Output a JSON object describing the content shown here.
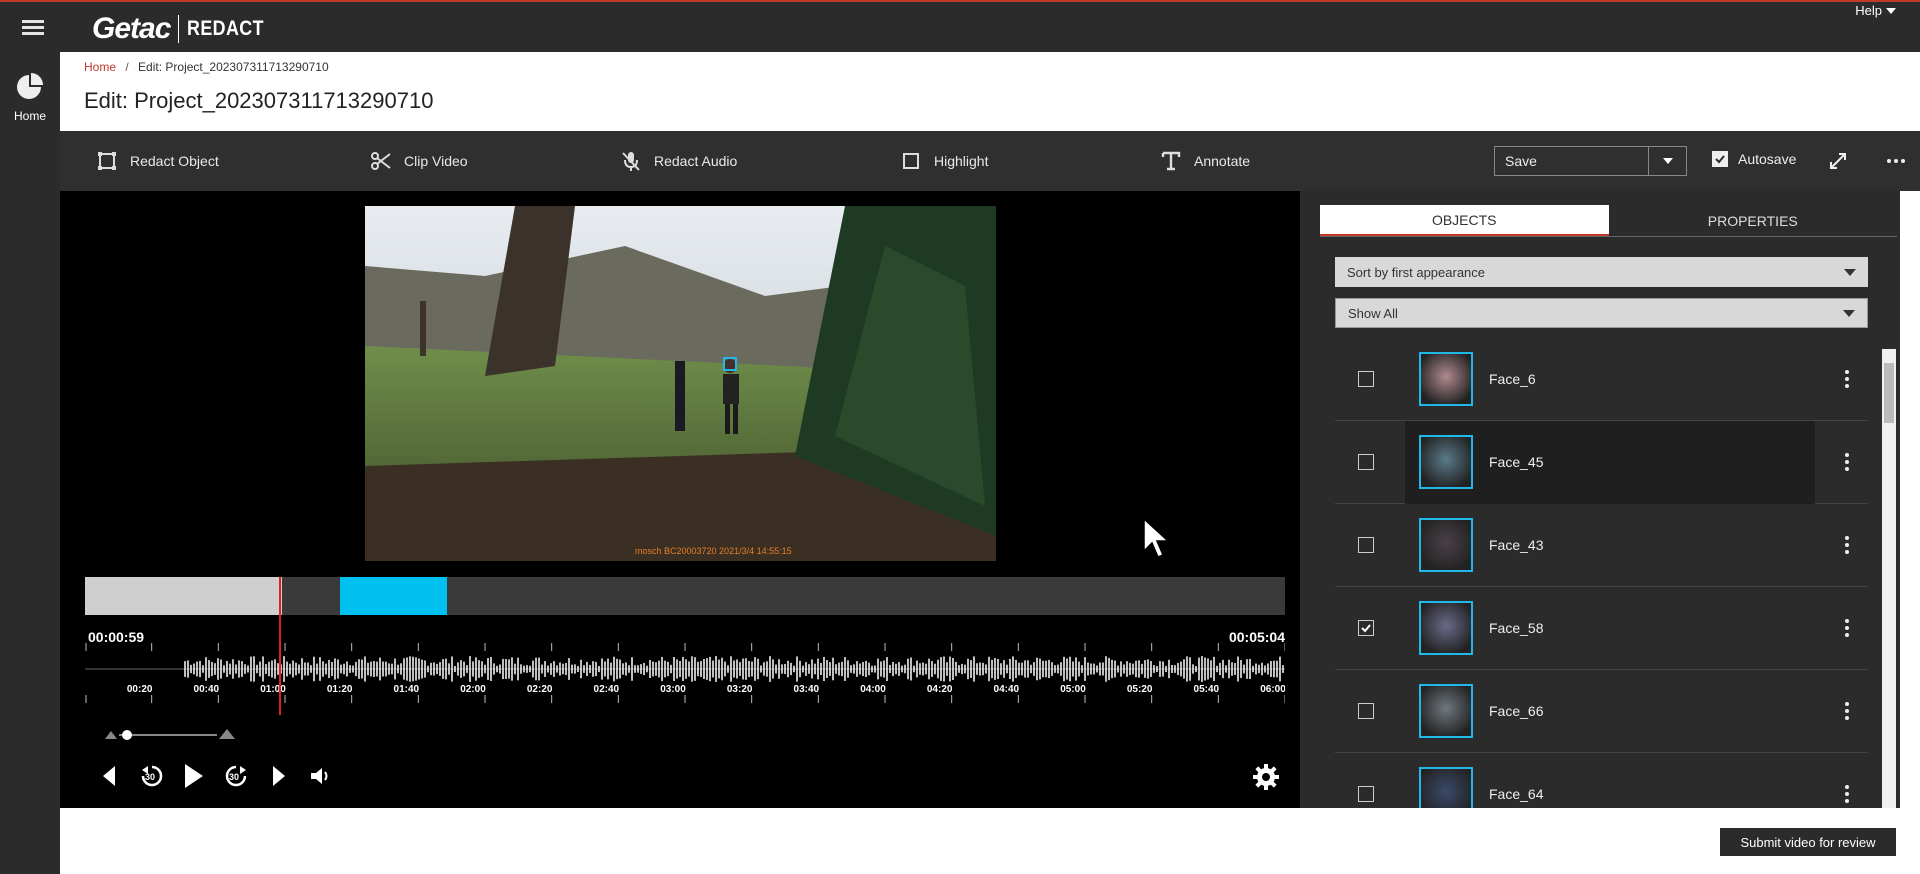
{
  "header": {
    "brand_logo": "Getac",
    "brand_product": "REDACT",
    "help_label": "Help"
  },
  "leftnav": {
    "home_label": "Home"
  },
  "breadcrumb": {
    "home": "Home",
    "separator": "/",
    "current": "Edit: Project_202307311713290710"
  },
  "page": {
    "title": "Edit: Project_202307311713290710"
  },
  "toolbar": {
    "redact_object": "Redact Object",
    "clip_video": "Clip Video",
    "redact_audio": "Redact Audio",
    "highlight": "Highlight",
    "annotate": "Annotate",
    "save_label": "Save",
    "autosave_label": "Autosave",
    "autosave_checked": true
  },
  "video": {
    "overlay_text": "mosch  BC20003720  2021/3/4  14:55:15",
    "current_time": "00:00:59",
    "total_time": "00:05:04",
    "ruler_labels": [
      "00:20",
      "00:40",
      "01:00",
      "01:20",
      "01:40",
      "02:00",
      "02:20",
      "02:40",
      "03:00",
      "03:20",
      "03:40",
      "04:00",
      "04:20",
      "04:40",
      "05:00",
      "05:20",
      "05:40",
      "06:00"
    ]
  },
  "panel": {
    "tab_objects": "OBJECTS",
    "tab_properties": "PROPERTIES",
    "sort_select": "Sort by first appearance",
    "filter_select": "Show All",
    "objects": [
      {
        "label": "Face_6",
        "checked": false
      },
      {
        "label": "Face_45",
        "checked": false
      },
      {
        "label": "Face_43",
        "checked": false
      },
      {
        "label": "Face_58",
        "checked": true
      },
      {
        "label": "Face_66",
        "checked": false
      },
      {
        "label": "Face_64",
        "checked": false
      }
    ]
  },
  "footer": {
    "submit_label": "Submit video for review"
  },
  "colors": {
    "accent": "#c0392b",
    "clip": "#00c0f0",
    "thumb_border": "#20b8e8",
    "playhead": "#e02020"
  }
}
